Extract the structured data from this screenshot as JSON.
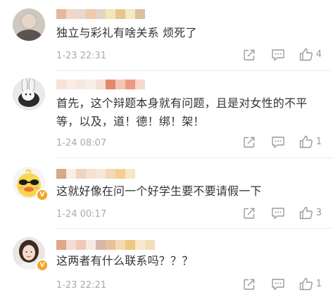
{
  "comments": [
    {
      "text": "独立与彩礼有啥关系 烦死了",
      "time": "1-23 22:31",
      "likes": "4",
      "verified": false,
      "avatar_icon": "blurred-person-avatar",
      "name_colors": [
        "#e7b79b",
        "#f1d7c8",
        "#e8d8cf",
        "#f3c9a9",
        "#e3d3c6",
        "#f6e5b9",
        "#e9c58e",
        "#f4e9c4",
        "#d9c29a"
      ]
    },
    {
      "text": "首先，这个辩题本身就有问题，且是对女性的不平等，以及，道！德！绑！架！",
      "time": "1-24 08:07",
      "likes": "1",
      "verified": false,
      "avatar_icon": "rabbit-avatar",
      "name_colors": [
        "#f6e2d6",
        "#f9ede6",
        "#f7e8df",
        "#f8efe9",
        "#f5e0d3",
        "#e38a6e",
        "#f2c7b5",
        "#ee9a80",
        "#f6d8cb"
      ]
    },
    {
      "text": "这就好像在问一个好学生要不要请假一下",
      "time": "1-24 00:17",
      "likes": "3",
      "verified": true,
      "avatar_icon": "duck-with-sunglasses-avatar",
      "name_colors": [
        "#d9a785",
        "#f7eee6",
        "#efd3bf",
        "#f5e1cf",
        "#f6e7d8",
        "#f3d9b5",
        "#f5cf8f",
        "#f7e6c8"
      ]
    },
    {
      "text": "这两者有什么联系吗？？？",
      "time": "1-23 22:21",
      "likes": "1",
      "verified": true,
      "avatar_icon": "woman-portrait-avatar",
      "name_colors": [
        "#e2a68a",
        "#f3ddd2",
        "#efc9b6",
        "#f6e9e2",
        "#d7b8a9",
        "#e8c19b",
        "#f4d9b4",
        "#f0c87d",
        "#f6e8cc",
        "#f2dfb8"
      ]
    }
  ],
  "actions": {
    "share_icon": "share-icon",
    "reply_icon": "comment-icon",
    "like_icon": "thumbs-up-icon"
  }
}
